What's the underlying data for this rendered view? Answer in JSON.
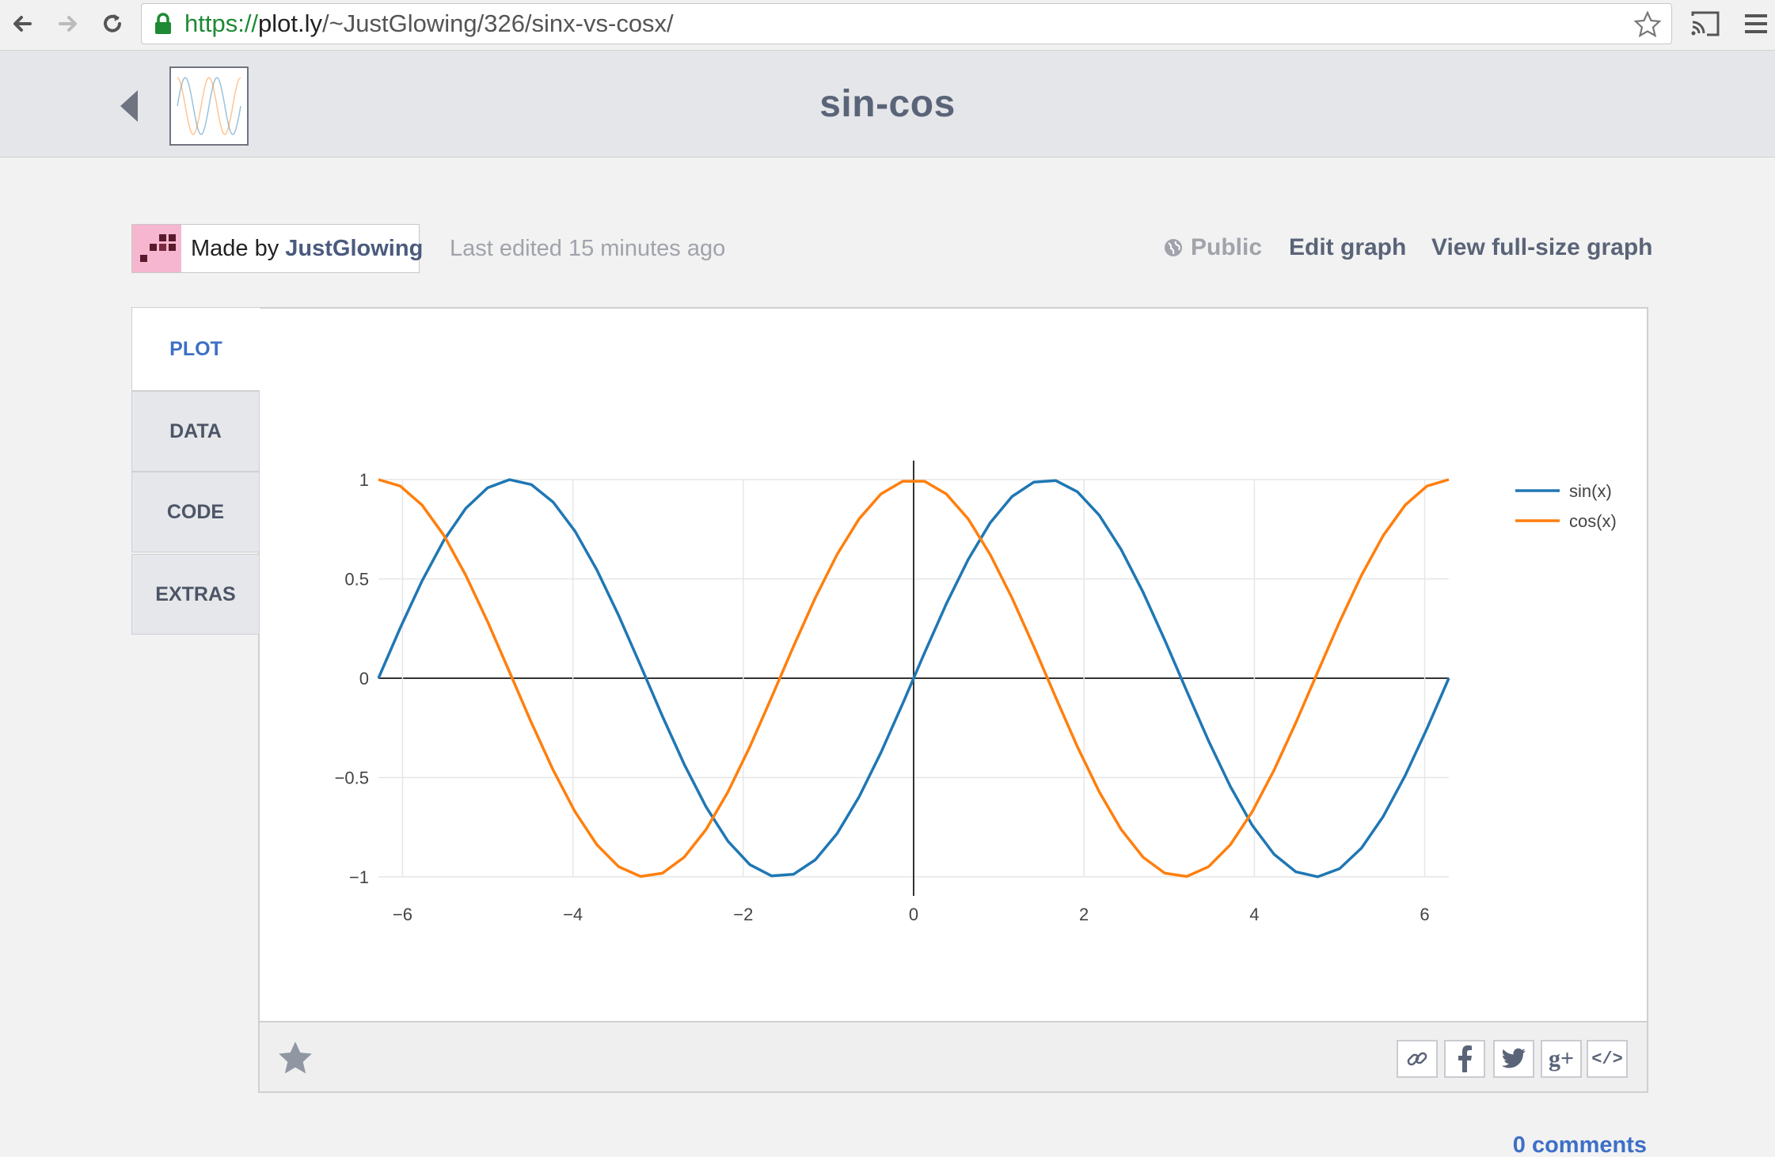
{
  "browser": {
    "url_scheme": "https://",
    "url_host": "plot.ly",
    "url_path": "/~JustGlowing/326/sinx-vs-cosx/"
  },
  "header": {
    "title": "sin-cos"
  },
  "meta": {
    "made_by_prefix": "Made by",
    "author": "JustGlowing",
    "last_edited": "Last edited 15 minutes ago",
    "visibility": "Public",
    "edit_graph": "Edit graph",
    "view_full_size": "View full-size graph"
  },
  "tabs": [
    {
      "label": "PLOT",
      "active": true
    },
    {
      "label": "DATA",
      "active": false
    },
    {
      "label": "CODE",
      "active": false
    },
    {
      "label": "EXTRAS",
      "active": false
    }
  ],
  "share": {
    "icons": [
      "link-icon",
      "facebook-icon",
      "twitter-icon",
      "google-plus-icon",
      "embed-icon"
    ],
    "gplus_label": "g+",
    "embed_label": "</>"
  },
  "comments_link": "0 comments",
  "colors": {
    "sin": "#1f77b4",
    "cos": "#ff7f0e",
    "accent": "#3d6fc6"
  },
  "chart_data": {
    "type": "line",
    "title": "",
    "xlabel": "",
    "ylabel": "",
    "xlim": [
      -6.283,
      6.283
    ],
    "ylim": [
      -1,
      1
    ],
    "xticks": [
      "−6",
      "−4",
      "−2",
      "0",
      "2",
      "4",
      "6"
    ],
    "xtick_values": [
      -6,
      -4,
      -2,
      0,
      2,
      4,
      6
    ],
    "yticks": [
      "1",
      "0.5",
      "0",
      "−0.5",
      "−1"
    ],
    "ytick_values": [
      1,
      0.5,
      0,
      -0.5,
      -1
    ],
    "grid": true,
    "legend_position": "top-right",
    "x_range": {
      "start": -6.2832,
      "end": 6.2832,
      "points": 50
    },
    "series": [
      {
        "name": "sin(x)",
        "function": "sin",
        "color": "#1f77b4"
      },
      {
        "name": "cos(x)",
        "function": "cos",
        "color": "#ff7f0e"
      }
    ]
  }
}
